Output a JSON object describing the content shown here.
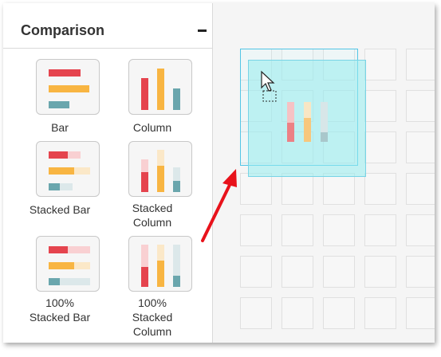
{
  "panel": {
    "title": "Comparison",
    "collapse_symbol": "–",
    "items": [
      {
        "label_lines": [
          "Bar"
        ],
        "icon": "bar-chart-icon"
      },
      {
        "label_lines": [
          "Column"
        ],
        "icon": "column-chart-icon"
      },
      {
        "label_lines": [
          "Stacked Bar"
        ],
        "icon": "stacked-bar-chart-icon"
      },
      {
        "label_lines": [
          "Stacked",
          "Column"
        ],
        "icon": "stacked-column-chart-icon"
      },
      {
        "label_lines": [
          "100%",
          "Stacked Bar"
        ],
        "icon": "full-stacked-bar-chart-icon"
      },
      {
        "label_lines": [
          "100%",
          "Stacked",
          "Column"
        ],
        "icon": "full-stacked-column-chart-icon"
      }
    ]
  },
  "colors": {
    "red": "#e5444e",
    "orange": "#f8b542",
    "teal": "#6aa6ad",
    "accent_outline": "#52c5e6",
    "arrow": "#e8121b"
  },
  "canvas": {
    "cursor_icon": "move-cursor-icon"
  }
}
